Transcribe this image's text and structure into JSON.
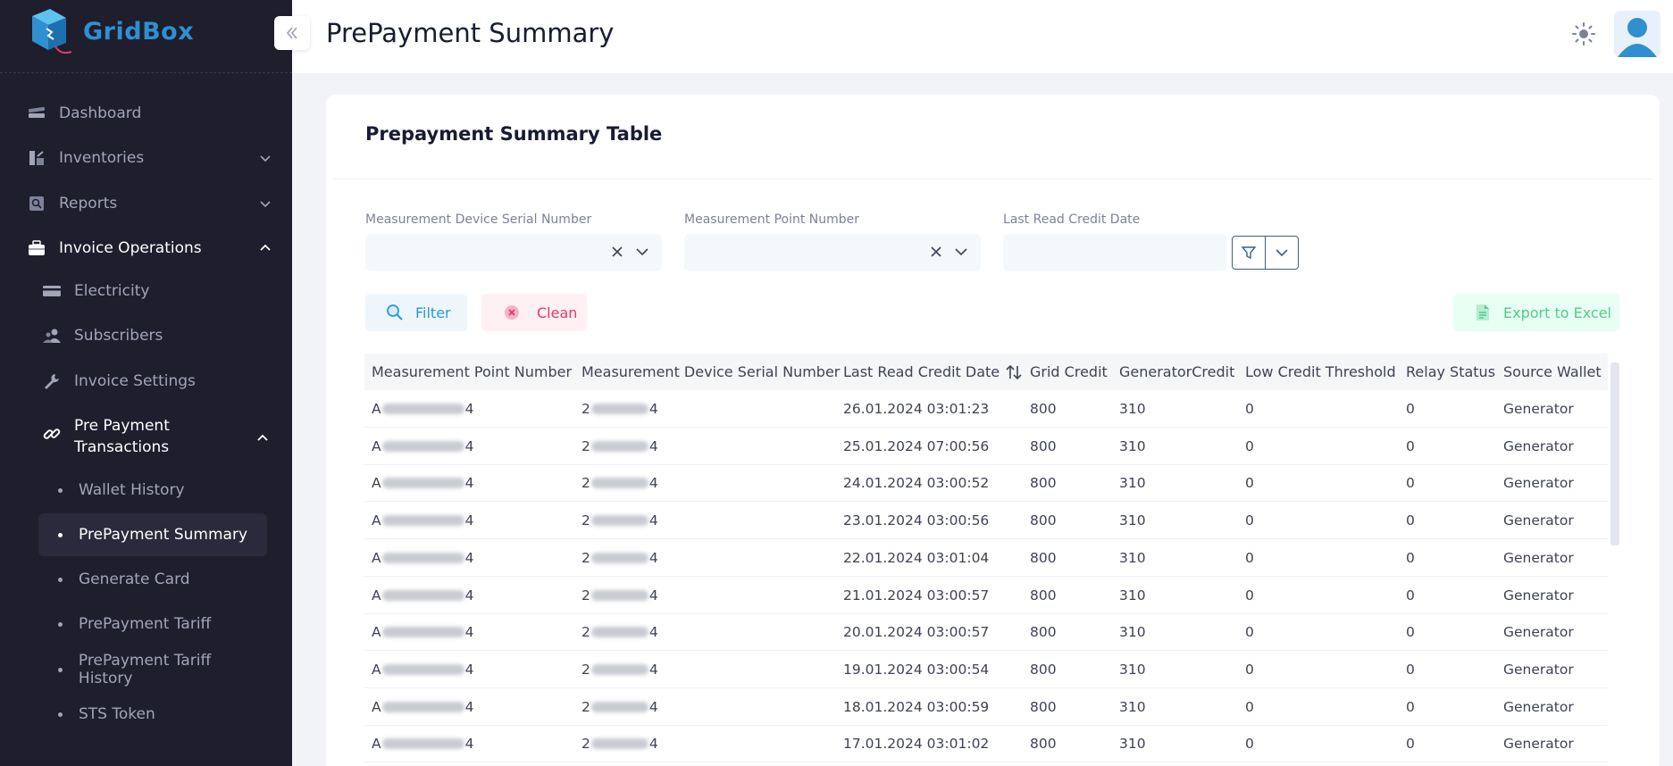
{
  "brand": {
    "name_part1": "Grid",
    "name_part2": "Box"
  },
  "header": {
    "title": "PrePayment Summary"
  },
  "sidebar": {
    "items": [
      {
        "label": "Dashboard",
        "icon": "dashboard-icon"
      },
      {
        "label": "Inventories",
        "icon": "inventory-icon"
      },
      {
        "label": "Reports",
        "icon": "reports-icon"
      },
      {
        "label": "Invoice Operations",
        "icon": "briefcase-icon"
      }
    ],
    "invoice_sub": [
      {
        "label": "Electricity",
        "icon": "card-icon"
      },
      {
        "label": "Subscribers",
        "icon": "users-icon"
      },
      {
        "label": "Invoice Settings",
        "icon": "wrench-icon"
      },
      {
        "label": "Pre Payment Transactions",
        "label_line1": "Pre Payment",
        "label_line2": "Transactions",
        "icon": "link-icon"
      }
    ],
    "prepayment_sub": [
      {
        "label": "Wallet History"
      },
      {
        "label": "PrePayment Summary"
      },
      {
        "label": "Generate Card"
      },
      {
        "label": "PrePayment Tariff"
      },
      {
        "label": "PrePayment Tariff History"
      },
      {
        "label": "STS Token"
      }
    ]
  },
  "card": {
    "title": "Prepayment Summary Table",
    "filters": {
      "device_serial_label": "Measurement Device Serial Number",
      "point_number_label": "Measurement Point Number",
      "last_read_label": "Last Read Credit Date"
    },
    "buttons": {
      "filter": "Filter",
      "clean": "Clean",
      "export": "Export to Excel"
    }
  },
  "table": {
    "columns": [
      "Measurement Point Number",
      "Measurement Device Serial Number",
      "Last Read Credit Date",
      "Grid Credit",
      "GeneratorCredit",
      "Low Credit Threshold",
      "Relay Status",
      "Source Wallet"
    ],
    "rows": [
      {
        "point_prefix": "A",
        "point_suffix": "4",
        "device_prefix": "2",
        "device_suffix": "4",
        "date": "26.01.2024 03:01:23",
        "grid": "800",
        "gen": "310",
        "low": "0",
        "relay": "0",
        "wallet": "Generator"
      },
      {
        "point_prefix": "A",
        "point_suffix": "4",
        "device_prefix": "2",
        "device_suffix": "4",
        "date": "25.01.2024 07:00:56",
        "grid": "800",
        "gen": "310",
        "low": "0",
        "relay": "0",
        "wallet": "Generator"
      },
      {
        "point_prefix": "A",
        "point_suffix": "4",
        "device_prefix": "2",
        "device_suffix": "4",
        "date": "24.01.2024 03:00:52",
        "grid": "800",
        "gen": "310",
        "low": "0",
        "relay": "0",
        "wallet": "Generator"
      },
      {
        "point_prefix": "A",
        "point_suffix": "4",
        "device_prefix": "2",
        "device_suffix": "4",
        "date": "23.01.2024 03:00:56",
        "grid": "800",
        "gen": "310",
        "low": "0",
        "relay": "0",
        "wallet": "Generator"
      },
      {
        "point_prefix": "A",
        "point_suffix": "4",
        "device_prefix": "2",
        "device_suffix": "4",
        "date": "22.01.2024 03:01:04",
        "grid": "800",
        "gen": "310",
        "low": "0",
        "relay": "0",
        "wallet": "Generator"
      },
      {
        "point_prefix": "A",
        "point_suffix": "4",
        "device_prefix": "2",
        "device_suffix": "4",
        "date": "21.01.2024 03:00:57",
        "grid": "800",
        "gen": "310",
        "low": "0",
        "relay": "0",
        "wallet": "Generator"
      },
      {
        "point_prefix": "A",
        "point_suffix": "4",
        "device_prefix": "2",
        "device_suffix": "4",
        "date": "20.01.2024 03:00:57",
        "grid": "800",
        "gen": "310",
        "low": "0",
        "relay": "0",
        "wallet": "Generator"
      },
      {
        "point_prefix": "A",
        "point_suffix": "4",
        "device_prefix": "2",
        "device_suffix": "4",
        "date": "19.01.2024 03:00:54",
        "grid": "800",
        "gen": "310",
        "low": "0",
        "relay": "0",
        "wallet": "Generator"
      },
      {
        "point_prefix": "A",
        "point_suffix": "4",
        "device_prefix": "2",
        "device_suffix": "4",
        "date": "18.01.2024 03:00:59",
        "grid": "800",
        "gen": "310",
        "low": "0",
        "relay": "0",
        "wallet": "Generator"
      },
      {
        "point_prefix": "A",
        "point_suffix": "4",
        "device_prefix": "2",
        "device_suffix": "4",
        "date": "17.01.2024 03:01:02",
        "grid": "800",
        "gen": "310",
        "low": "0",
        "relay": "0",
        "wallet": "Generator"
      }
    ]
  },
  "colors": {
    "sidebar_bg": "#1e1e2d",
    "accent_blue": "#2b9ad6",
    "danger": "#e5386b",
    "success": "#50cd89"
  }
}
